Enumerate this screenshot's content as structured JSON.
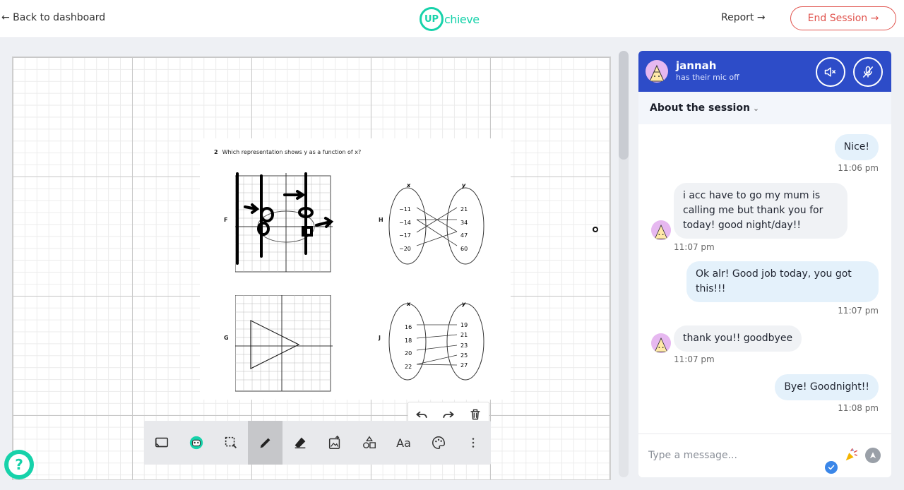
{
  "header": {
    "back_label": "← Back to dashboard",
    "logo_up": "UP",
    "logo_rest": "chieve",
    "report_label": "Report →",
    "end_label": "End Session →"
  },
  "worksheet": {
    "question_number": "2",
    "question_text": "Which representation shows y as a function of x?",
    "options": [
      "F",
      "G",
      "H",
      "J"
    ],
    "H": {
      "x": [
        "−11",
        "−14",
        "−17",
        "−20"
      ],
      "y": [
        "21",
        "34",
        "47",
        "60"
      ]
    },
    "J": {
      "x": [
        "16",
        "18",
        "20",
        "22"
      ],
      "y": [
        "19",
        "21",
        "23",
        "25",
        "27"
      ]
    },
    "axis_x": "x",
    "axis_y": "y"
  },
  "toolbar": {
    "tools": [
      "screen-share",
      "robot",
      "select",
      "pen",
      "eraser",
      "image-upload",
      "shapes",
      "text",
      "palette",
      "more"
    ],
    "active_tool": "pen",
    "text_tool_label": "Aa"
  },
  "chat": {
    "partner_name": "jannah",
    "partner_status": "has their mic off",
    "about_label": "About the session",
    "messages": [
      {
        "side": "out",
        "text": "Nice!",
        "time": "11:06 pm"
      },
      {
        "side": "in",
        "text": "i acc have to go my mum is calling me but thank you for today! good night/day!!",
        "time": "11:07 pm"
      },
      {
        "side": "out",
        "text": "Ok alr! Good job today, you got this!!!",
        "time": "11:07 pm"
      },
      {
        "side": "in",
        "text": "thank you!! goodbyee",
        "time": "11:07 pm"
      },
      {
        "side": "out",
        "text": "Bye! Goodnight!!",
        "time": "11:08 pm"
      }
    ],
    "composer_placeholder": "Type a message..."
  },
  "help_label": "?",
  "colors": {
    "brand": "#16d2aa",
    "danger": "#e0524c",
    "chat_header": "#2d4cc8"
  }
}
